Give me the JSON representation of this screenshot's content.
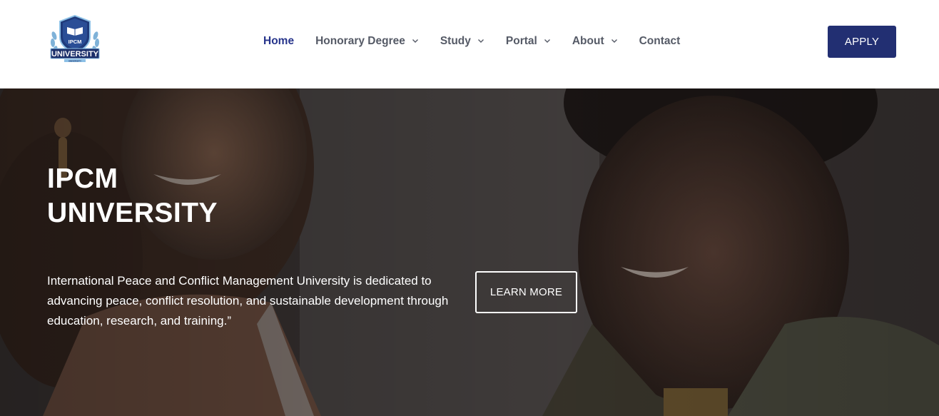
{
  "logo": {
    "top_text": "IPCM",
    "main_text": "UNIVERSITY",
    "small_text": "UNIVERSITY"
  },
  "nav": {
    "items": [
      {
        "label": "Home",
        "dropdown": false,
        "active": true
      },
      {
        "label": "Honorary Degree",
        "dropdown": true,
        "active": false
      },
      {
        "label": "Study",
        "dropdown": true,
        "active": false
      },
      {
        "label": "Portal",
        "dropdown": true,
        "active": false
      },
      {
        "label": "About",
        "dropdown": true,
        "active": false
      },
      {
        "label": "Contact",
        "dropdown": false,
        "active": false
      }
    ]
  },
  "apply_button": {
    "label": "APPLY"
  },
  "hero": {
    "title_line1": "IPCM",
    "title_line2": "UNIVERSITY",
    "description": "International Peace and Conflict Management University is dedicated to advancing peace, conflict resolution, and sustainable development through education, research, and training.”",
    "cta_label": "LEARN MORE"
  },
  "colors": {
    "brand_navy": "#222f72",
    "nav_active": "#26348b",
    "nav_text": "#555a66",
    "hero_overlay": "#2b2b2b"
  }
}
